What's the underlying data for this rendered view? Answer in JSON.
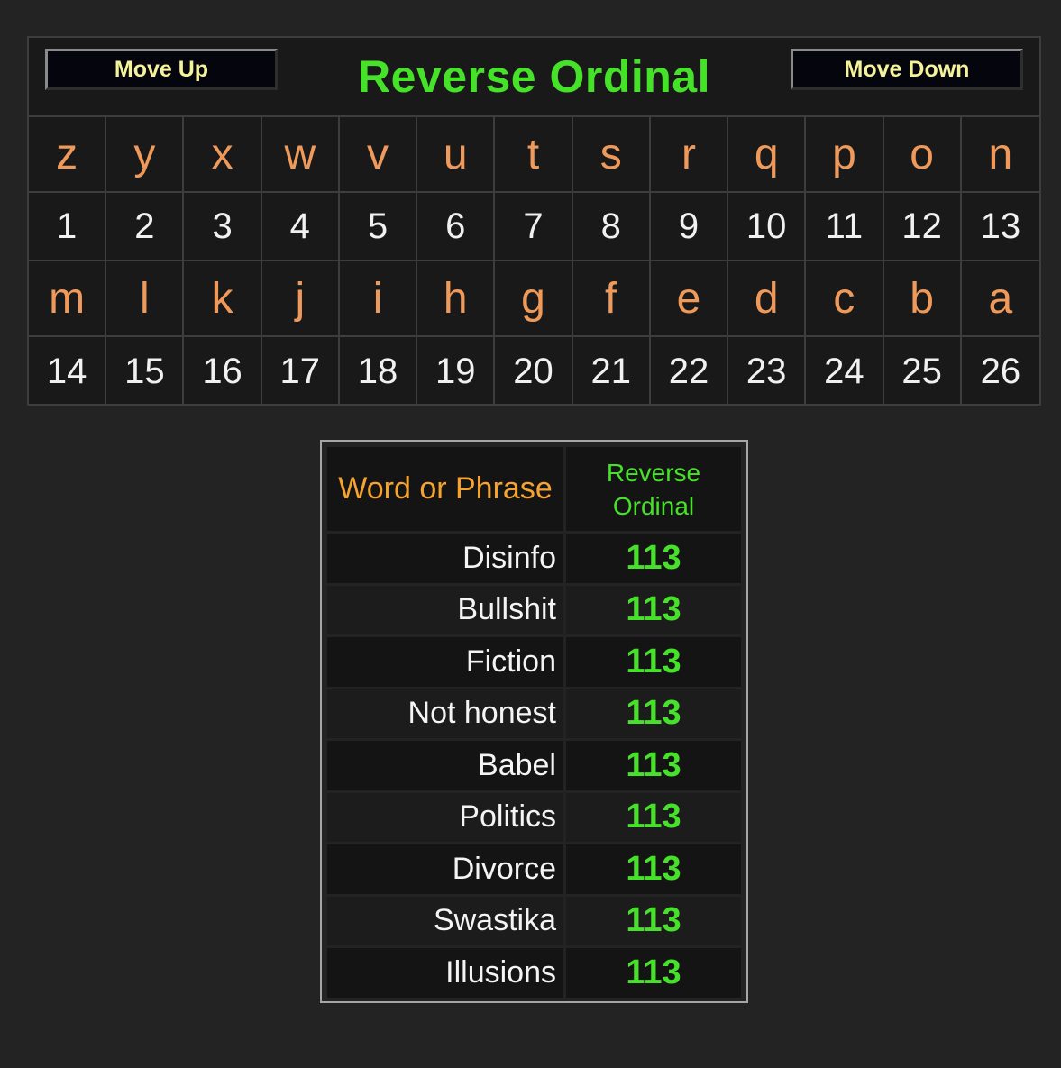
{
  "header": {
    "move_up_label": "Move Up",
    "move_down_label": "Move Down",
    "title": "Reverse Ordinal"
  },
  "cipher_rows": [
    {
      "letters": [
        "z",
        "y",
        "x",
        "w",
        "v",
        "u",
        "t",
        "s",
        "r",
        "q",
        "p",
        "o",
        "n"
      ],
      "values": [
        "1",
        "2",
        "3",
        "4",
        "5",
        "6",
        "7",
        "8",
        "9",
        "10",
        "11",
        "12",
        "13"
      ]
    },
    {
      "letters": [
        "m",
        "l",
        "k",
        "j",
        "i",
        "h",
        "g",
        "f",
        "e",
        "d",
        "c",
        "b",
        "a"
      ],
      "values": [
        "14",
        "15",
        "16",
        "17",
        "18",
        "19",
        "20",
        "21",
        "22",
        "23",
        "24",
        "25",
        "26"
      ]
    }
  ],
  "results": {
    "column_headers": [
      "Word or Phrase",
      "Reverse Ordinal"
    ],
    "rows": [
      {
        "phrase": "Disinfo",
        "value": "113"
      },
      {
        "phrase": "Bullshit",
        "value": "113"
      },
      {
        "phrase": "Fiction",
        "value": "113"
      },
      {
        "phrase": "Not honest",
        "value": "113"
      },
      {
        "phrase": "Babel",
        "value": "113"
      },
      {
        "phrase": "Politics",
        "value": "113"
      },
      {
        "phrase": "Divorce",
        "value": "113"
      },
      {
        "phrase": "Swastika",
        "value": "113"
      },
      {
        "phrase": "Illusions",
        "value": "113"
      }
    ]
  },
  "colors": {
    "title_green": "#46e22a",
    "letter_orange": "#ef9a5a",
    "header_orange": "#f5a331",
    "button_text": "#f4f29a"
  }
}
